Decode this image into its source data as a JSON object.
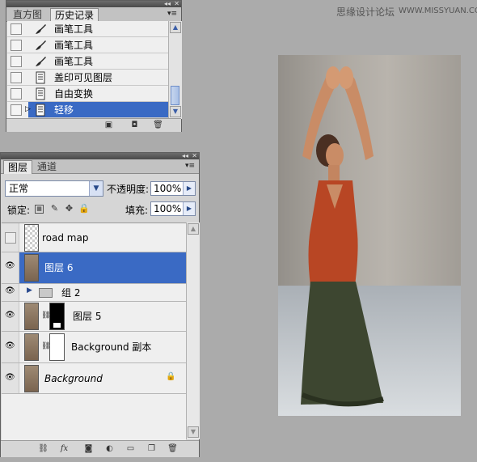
{
  "watermark": {
    "site_name": "思缘设计论坛",
    "url": "WWW.MISSYUAN.COM"
  },
  "history_panel": {
    "tabs": [
      "直方图",
      "历史记录"
    ],
    "active_tab_index": 1,
    "items": [
      {
        "label": "画笔工具",
        "icon": "brush-icon"
      },
      {
        "label": "画笔工具",
        "icon": "brush-icon"
      },
      {
        "label": "画笔工具",
        "icon": "brush-icon"
      },
      {
        "label": "盖印可见图层",
        "icon": "history-state-icon"
      },
      {
        "label": "自由变换",
        "icon": "history-state-icon"
      },
      {
        "label": "轻移",
        "icon": "history-state-icon",
        "selected": true
      }
    ],
    "footer_icons": [
      "new-document-from-state-icon",
      "new-snapshot-icon",
      "delete-state-icon"
    ]
  },
  "layers_panel": {
    "tabs": [
      "图层",
      "通道"
    ],
    "active_tab_index": 0,
    "blend_mode": "正常",
    "opacity_label": "不透明度:",
    "opacity_value": "100%",
    "lock_label": "锁定:",
    "fill_label": "填充:",
    "fill_value": "100%",
    "layers": [
      {
        "name": "road map",
        "visible": false,
        "thumbnail": "transparent"
      },
      {
        "name": "图层 6",
        "visible": true,
        "selected": true,
        "thumbnail": "photo"
      },
      {
        "name": "组 2",
        "visible": true,
        "type": "group"
      },
      {
        "name": "图层 5",
        "visible": true,
        "thumbnail": "photo",
        "mask": "black-with-white-feet"
      },
      {
        "name": "Background 副本",
        "visible": true,
        "thumbnail": "photo",
        "mask": "white"
      },
      {
        "name": "Background",
        "visible": true,
        "thumbnail": "photo",
        "locked": true,
        "italic": true
      }
    ],
    "footer_icons": [
      "link-layers-icon",
      "layer-style-icon",
      "add-mask-icon",
      "adjustment-layer-icon",
      "new-group-icon",
      "new-layer-icon",
      "delete-layer-icon"
    ]
  },
  "colors": {
    "selection": "#3a6ac4",
    "panel_bg": "#d6d6d6",
    "canvas_bg": "#ababab"
  }
}
